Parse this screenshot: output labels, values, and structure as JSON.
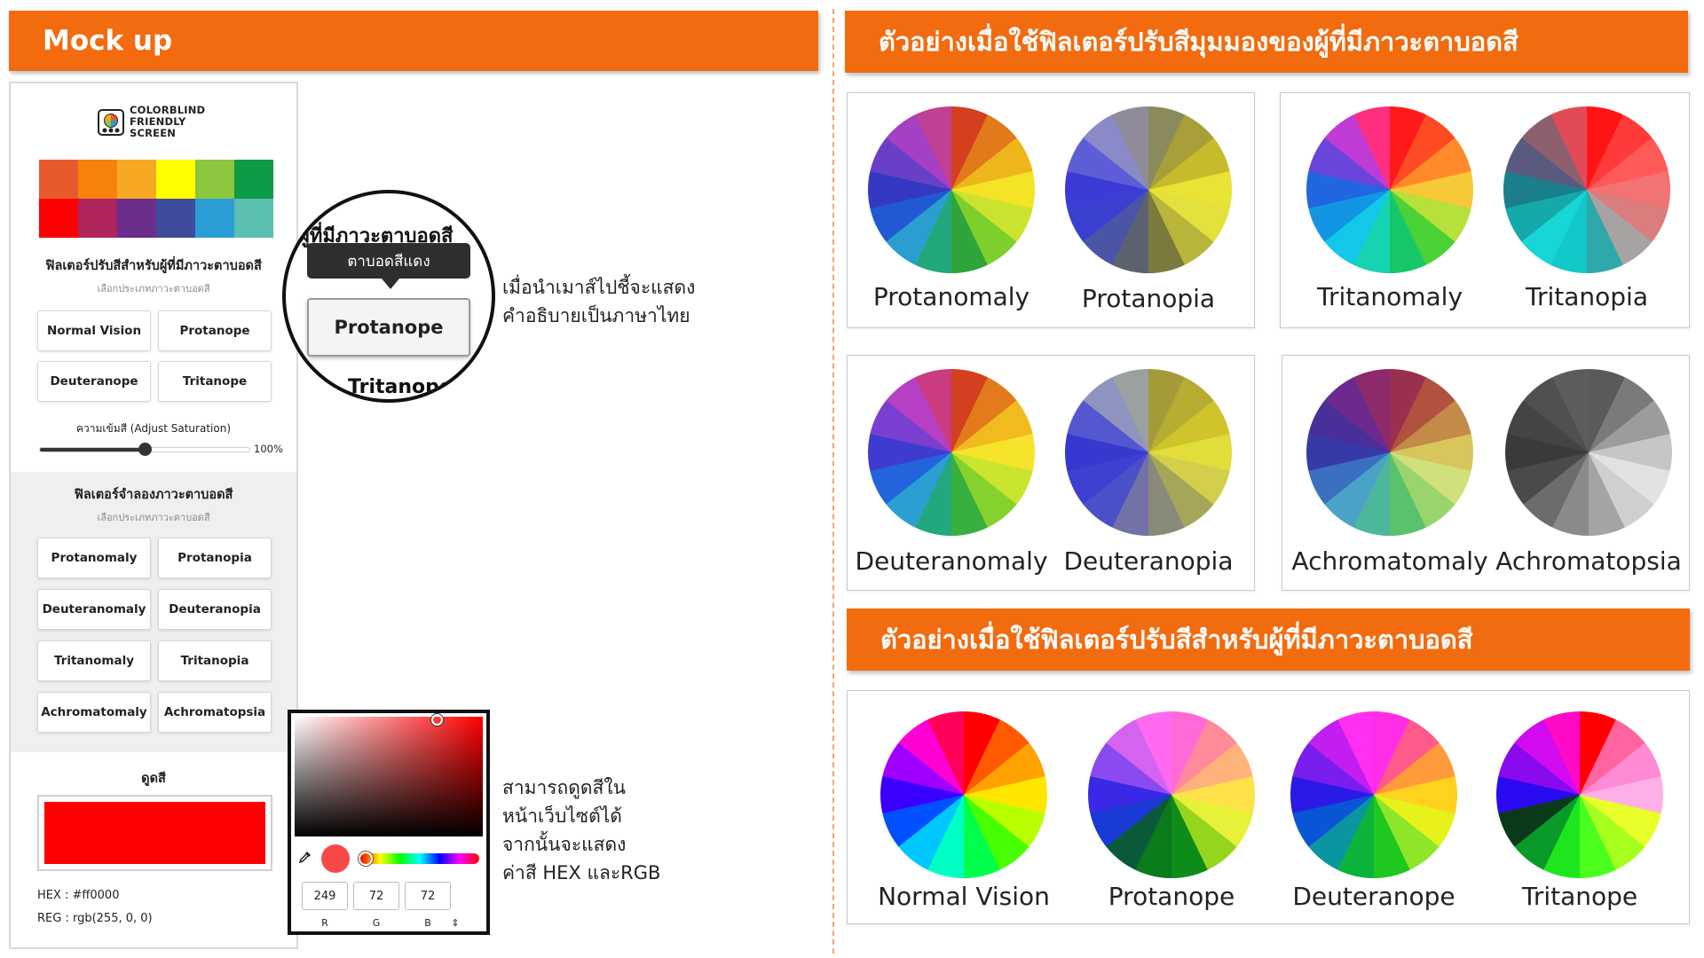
{
  "left_banner": {
    "title": "Mock up"
  },
  "right_banner_top": {
    "title": "ตัวอย่างเมื่อใช้ฟิลเตอร์ปรับสีมุมมองของผู้ที่มีภาวะตาบอดสี"
  },
  "right_banner_bottom": {
    "title": "ตัวอย่างเมื่อใช้ฟิลเตอร์ปรับสีสำหรับผู้ที่มีภาวะตาบอดสี"
  },
  "mockup": {
    "logo_lines": [
      "COLORBLIND",
      "FRIENDLY",
      "SCREEN"
    ],
    "palette_colors": [
      "#e85a2c",
      "#f6820d",
      "#f7a823",
      "#ffff00",
      "#8dc63f",
      "#0f9a48",
      "#ff0000",
      "#b0245e",
      "#6c2e8c",
      "#3e4a9a",
      "#2a9ed4",
      "#5bbfb0"
    ],
    "filter_section": {
      "title": "ฟิลเตอร์ปรับสีสำหรับผู้ที่มีภาวะตาบอดสี",
      "subtitle": "เลือกประเภทภาวะตาบอดสี",
      "buttons": [
        "Normal Vision",
        "Protanope",
        "Deuteranope",
        "Tritanope"
      ]
    },
    "saturation": {
      "label": "ความเข้มสี (Adjust Saturation)",
      "value_label": "100%",
      "level": 0.5
    },
    "simulation_section": {
      "title": "ฟิลเตอร์จำลองภาวะตาบอดสี",
      "subtitle": "เลือกประเภทภาวะตาบอดสี",
      "buttons": [
        "Protanomaly",
        "Protanopia",
        "Deuteranomaly",
        "Deuteranopia",
        "Tritanomaly",
        "Tritanopia",
        "Achromatomaly",
        "Achromatopsia"
      ]
    },
    "picker_section": {
      "title": "ดูดสี",
      "preview_color": "#ff0000",
      "hex_line": "HEX : #ff0000",
      "rgb_line": "REG : rgb(255, 0, 0)"
    }
  },
  "zoom": {
    "heading": "ผู้ที่มีภาวะตาบอดสี",
    "tooltip": "ตาบอดสีแดง",
    "button": "Protanope",
    "fragment": "Tritanope"
  },
  "note_hover": [
    "เมื่อนำเมาส์ไปชี้จะแสดง",
    "คำอธิบายเป็นภาษาไทย"
  ],
  "note_picker": [
    "สามารถดูดสีใน",
    "หน้าเว็บไซต์ได้",
    "จากนั้นจะแสดง",
    "ค่าสี HEX และRGB"
  ],
  "color_picker": {
    "swatch_color": "#f94848",
    "r": "249",
    "g": "72",
    "b": "72",
    "labels": [
      "R",
      "G",
      "B"
    ],
    "toggle_icon": "⇕"
  },
  "simulation_wheels": [
    {
      "label": "Protanomaly",
      "palette": [
        "#d2401f",
        "#e07a1a",
        "#efb61c",
        "#f5e326",
        "#cbe32e",
        "#7fcf2c",
        "#2ea43a",
        "#23a87e",
        "#2a9fcf",
        "#2159d2",
        "#3438c2",
        "#6a3fc8",
        "#a53fc4",
        "#c04095"
      ]
    },
    {
      "label": "Protanopia",
      "palette": [
        "#8b8a5c",
        "#a89f3a",
        "#c7bb2b",
        "#e8e334",
        "#e3e13c",
        "#b7b53a",
        "#7a7a3c",
        "#5c6170",
        "#4a55a8",
        "#3b3fd0",
        "#3c3bd6",
        "#5d5ed6",
        "#8a8ac8",
        "#8f8b98"
      ]
    },
    {
      "label": "Tritanomaly",
      "palette": [
        "#ff1a1a",
        "#ff4b24",
        "#ff8a2a",
        "#f7c838",
        "#b6e03a",
        "#4bd236",
        "#17c76a",
        "#16d3b2",
        "#12c8e8",
        "#1296e4",
        "#2166e0",
        "#6a45dc",
        "#c03bd6",
        "#ff2f7f"
      ]
    },
    {
      "label": "Tritanopia",
      "palette": [
        "#ff1414",
        "#ff3a3a",
        "#ff5a5a",
        "#f27373",
        "#d97d7d",
        "#a7a3a3",
        "#2ea8a8",
        "#12c8c8",
        "#18d6d6",
        "#15a9a9",
        "#1a7f8a",
        "#5a5a7f",
        "#8d5f6f",
        "#e24a58"
      ]
    },
    {
      "label": "Deuteranomaly",
      "palette": [
        "#d2401f",
        "#e37a1c",
        "#f1bb20",
        "#f6e42c",
        "#c9e52e",
        "#86d22d",
        "#38b040",
        "#23a77e",
        "#2b9fd2",
        "#2264dc",
        "#3f3bd0",
        "#7a3fd0",
        "#b63fc6",
        "#c93c7f"
      ]
    },
    {
      "label": "Deuteranopia",
      "palette": [
        "#a59a3a",
        "#b7ad32",
        "#cfc42c",
        "#e1dd3a",
        "#d2cf4a",
        "#a6a65a",
        "#8a8a7a",
        "#7272a6",
        "#4b4fc8",
        "#3f3fd2",
        "#3638cf",
        "#5457cf",
        "#8f93c0",
        "#9ba0a0"
      ]
    },
    {
      "label": "Achromatomaly",
      "palette": [
        "#9a2f50",
        "#b0523e",
        "#c38a48",
        "#d6c65c",
        "#cfe07c",
        "#9ad46c",
        "#5ac16c",
        "#4cb79a",
        "#4aa3c6",
        "#3b6fc0",
        "#353aa8",
        "#4a2f9a",
        "#6c2a8f",
        "#8c2a6c"
      ]
    },
    {
      "label": "Achromatopsia",
      "palette": [
        "#5a5a5a",
        "#7a7a7a",
        "#9c9c9c",
        "#c6c6c6",
        "#e2e2e2",
        "#cfcfcf",
        "#a4a4a4",
        "#8a8a8a",
        "#6c6c6c",
        "#4a4a4a",
        "#3a3a3a",
        "#444444",
        "#505050",
        "#5c5c5c"
      ]
    }
  ],
  "filter_wheels": [
    {
      "label": "Normal Vision",
      "palette": [
        "#ff0000",
        "#ff5a00",
        "#ffa200",
        "#ffe600",
        "#b8ff00",
        "#46ff00",
        "#00ff4a",
        "#00ffc4",
        "#00c8ff",
        "#0050ff",
        "#3a00ff",
        "#a000ff",
        "#ff00d2",
        "#ff005a"
      ]
    },
    {
      "label": "Protanope",
      "palette": [
        "#ff6ad6",
        "#ff8a9a",
        "#ffb37a",
        "#ffe14a",
        "#e6f23a",
        "#96d51e",
        "#0d8c1a",
        "#0a7a1a",
        "#0a5a3a",
        "#1a3ad6",
        "#3a28e6",
        "#8a4af0",
        "#d464f0",
        "#ff6af0"
      ]
    },
    {
      "label": "Deuteranope",
      "palette": [
        "#ff2ee6",
        "#ff5a8a",
        "#ff9a3a",
        "#ffd21e",
        "#e6f21a",
        "#8ee62a",
        "#1ec81e",
        "#0ab43a",
        "#0a96a0",
        "#0a54d6",
        "#2a1ae6",
        "#7a1ef0",
        "#c21ef0",
        "#ff2ef0"
      ]
    },
    {
      "label": "Tritanope",
      "palette": [
        "#ff0000",
        "#ff64a0",
        "#ff8ad6",
        "#ffb0e6",
        "#eaff2a",
        "#a6ff1e",
        "#4aff1e",
        "#1ee61e",
        "#0a9a2a",
        "#0a3a1a",
        "#2a0af0",
        "#8a0af0",
        "#d20af0",
        "#ff0ac8"
      ]
    }
  ]
}
